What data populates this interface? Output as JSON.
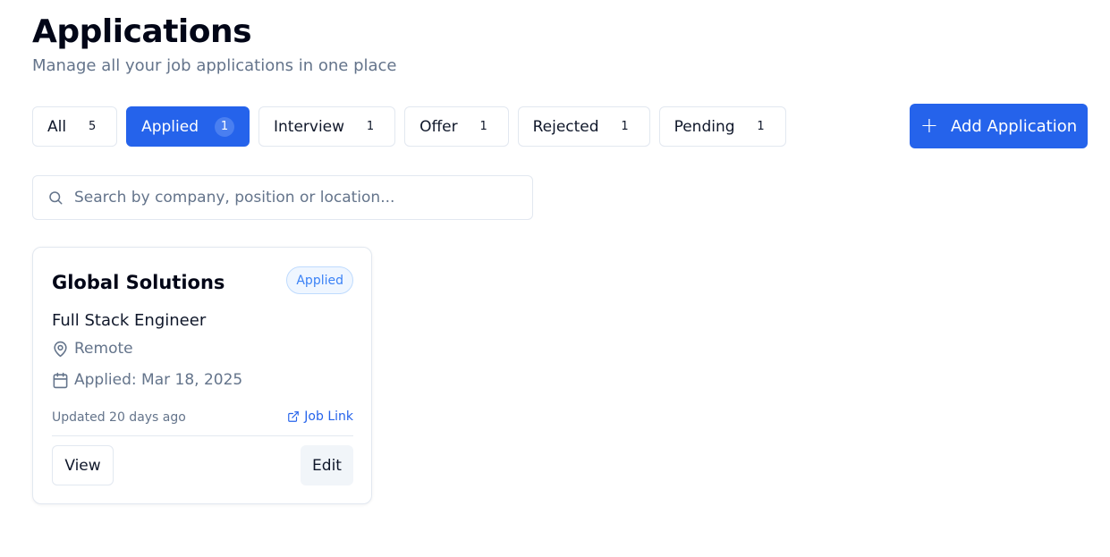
{
  "header": {
    "title": "Applications",
    "subtitle": "Manage all your job applications in one place"
  },
  "tabs": [
    {
      "label": "All",
      "count": "5",
      "active": false
    },
    {
      "label": "Applied",
      "count": "1",
      "active": true
    },
    {
      "label": "Interview",
      "count": "1",
      "active": false
    },
    {
      "label": "Offer",
      "count": "1",
      "active": false
    },
    {
      "label": "Rejected",
      "count": "1",
      "active": false
    },
    {
      "label": "Pending",
      "count": "1",
      "active": false
    }
  ],
  "add_button": {
    "label": "Add Application",
    "icon": "plus-icon"
  },
  "search": {
    "placeholder": "Search by company, position or location...",
    "value": "",
    "icon": "search-icon"
  },
  "applications": [
    {
      "company": "Global Solutions",
      "status": "Applied",
      "position": "Full Stack Engineer",
      "location": "Remote",
      "applied_date": "Applied: Mar 18, 2025",
      "updated": "Updated 20 days ago",
      "job_link_label": "Job Link",
      "view_label": "View",
      "edit_label": "Edit"
    }
  ],
  "colors": {
    "accent": "#2563eb",
    "muted_text": "#64748b",
    "border": "#e2e8f0",
    "badge_bg": "#eff6ff",
    "badge_text": "#3b82f6"
  }
}
